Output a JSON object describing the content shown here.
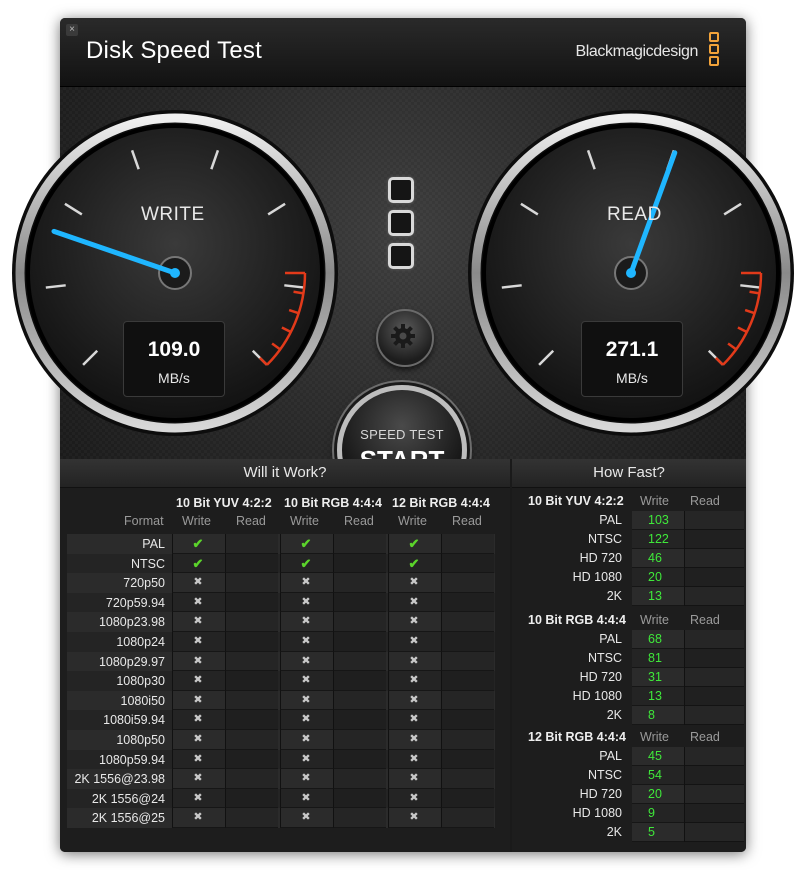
{
  "window": {
    "title": "Disk Speed Test",
    "brand": "Blackmagicdesign",
    "close_glyph": "×"
  },
  "gauges": {
    "write": {
      "label": "WRITE",
      "value": "109.0",
      "unit": "MB/s"
    },
    "read": {
      "label": "READ",
      "value": "271.1",
      "unit": "MB/s"
    }
  },
  "start_button": {
    "sub": "SPEED TEST",
    "main": "START"
  },
  "icons": {
    "settings": "gear-icon",
    "status_lights": "led-stack-icon",
    "ok": "check-icon",
    "no": "cross-icon"
  },
  "colors": {
    "needle": "#1fb6ff",
    "brand": "#f2a33a",
    "ok": "#5bd32b",
    "rate": "#3fe83a",
    "redzone": "#e23a1a"
  },
  "will_it_work": {
    "title": "Will it Work?",
    "format_label": "Format",
    "groups": [
      "10 Bit YUV 4:2:2",
      "10 Bit RGB 4:4:4",
      "12 Bit RGB 4:4:4"
    ],
    "sub_write": "Write",
    "sub_read": "Read",
    "ok_glyph": "✔",
    "no_glyph": "✖",
    "rows": [
      {
        "format": "PAL",
        "yuv": true,
        "rgb10": true,
        "rgb12": true
      },
      {
        "format": "NTSC",
        "yuv": true,
        "rgb10": true,
        "rgb12": true
      },
      {
        "format": "720p50",
        "yuv": false,
        "rgb10": false,
        "rgb12": false
      },
      {
        "format": "720p59.94",
        "yuv": false,
        "rgb10": false,
        "rgb12": false
      },
      {
        "format": "1080p23.98",
        "yuv": false,
        "rgb10": false,
        "rgb12": false
      },
      {
        "format": "1080p24",
        "yuv": false,
        "rgb10": false,
        "rgb12": false
      },
      {
        "format": "1080p29.97",
        "yuv": false,
        "rgb10": false,
        "rgb12": false
      },
      {
        "format": "1080p30",
        "yuv": false,
        "rgb10": false,
        "rgb12": false
      },
      {
        "format": "1080i50",
        "yuv": false,
        "rgb10": false,
        "rgb12": false
      },
      {
        "format": "1080i59.94",
        "yuv": false,
        "rgb10": false,
        "rgb12": false
      },
      {
        "format": "1080p50",
        "yuv": false,
        "rgb10": false,
        "rgb12": false
      },
      {
        "format": "1080p59.94",
        "yuv": false,
        "rgb10": false,
        "rgb12": false
      },
      {
        "format": "2K 1556@23.98",
        "yuv": false,
        "rgb10": false,
        "rgb12": false
      },
      {
        "format": "2K 1556@24",
        "yuv": false,
        "rgb10": false,
        "rgb12": false
      },
      {
        "format": "2K 1556@25",
        "yuv": false,
        "rgb10": false,
        "rgb12": false
      }
    ]
  },
  "how_fast": {
    "title": "How Fast?",
    "sub_write": "Write",
    "sub_read": "Read",
    "groups": [
      {
        "name": "10 Bit YUV 4:2:2",
        "rows": [
          {
            "format": "PAL",
            "write": "103"
          },
          {
            "format": "NTSC",
            "write": "122"
          },
          {
            "format": "HD 720",
            "write": "46"
          },
          {
            "format": "HD 1080",
            "write": "20"
          },
          {
            "format": "2K",
            "write": "13"
          }
        ]
      },
      {
        "name": "10 Bit RGB 4:4:4",
        "rows": [
          {
            "format": "PAL",
            "write": "68"
          },
          {
            "format": "NTSC",
            "write": "81"
          },
          {
            "format": "HD 720",
            "write": "31"
          },
          {
            "format": "HD 1080",
            "write": "13"
          },
          {
            "format": "2K",
            "write": "8"
          }
        ]
      },
      {
        "name": "12 Bit RGB 4:4:4",
        "rows": [
          {
            "format": "PAL",
            "write": "45"
          },
          {
            "format": "NTSC",
            "write": "54"
          },
          {
            "format": "HD 720",
            "write": "20"
          },
          {
            "format": "HD 1080",
            "write": "9"
          },
          {
            "format": "2K",
            "write": "5"
          }
        ]
      }
    ]
  }
}
